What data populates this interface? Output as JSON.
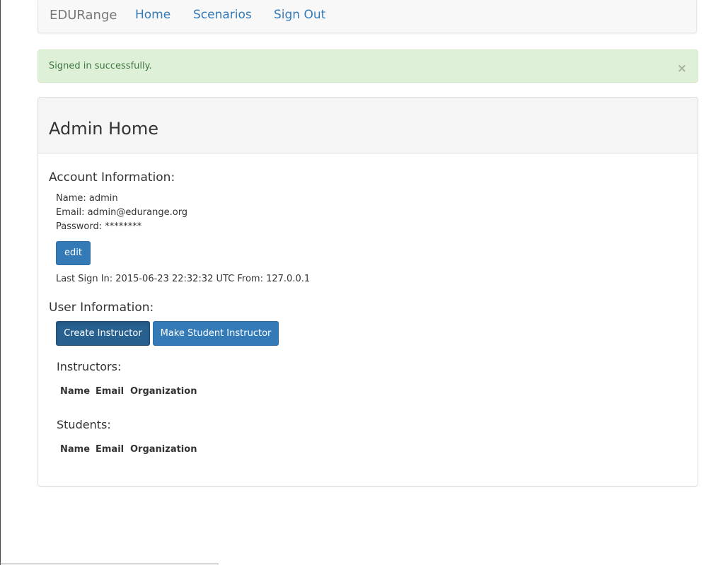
{
  "navbar": {
    "brand": "EDURange",
    "links": [
      "Home",
      "Scenarios",
      "Sign Out"
    ]
  },
  "alert": {
    "message": "Signed in successfully.",
    "close_glyph": "×"
  },
  "panel": {
    "title": "Admin Home"
  },
  "account": {
    "heading": "Account Information:",
    "name_line": "Name: admin",
    "email_line": "Email: admin@edurange.org",
    "password_line": "Password: ********",
    "edit_label": "edit",
    "last_sign_in": "Last Sign In: 2015-06-23 22:32:32 UTC From: 127.0.0.1"
  },
  "users": {
    "heading": "User Information:",
    "create_instructor_label": "Create Instructor",
    "make_student_instructor_label": "Make Student Instructor",
    "instructors": {
      "heading": "Instructors:",
      "columns": [
        "Name",
        "Email",
        "Organization"
      ]
    },
    "students": {
      "heading": "Students:",
      "columns": [
        "Name",
        "Email",
        "Organization"
      ]
    }
  },
  "colors": {
    "link": "#337ab7",
    "primary": "#337ab7",
    "primary_active": "#286090",
    "success_bg": "#dff0d8",
    "success_text": "#3c763d"
  }
}
